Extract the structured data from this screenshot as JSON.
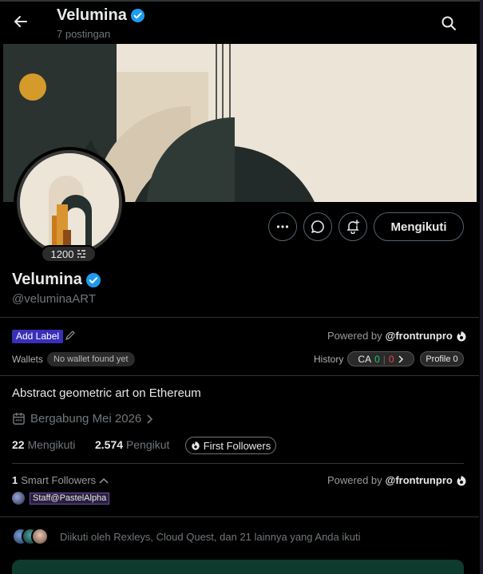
{
  "header": {
    "title": "Velumina",
    "subtitle": "7 postingan",
    "back_icon": "arrow-left-icon",
    "search_icon": "search-icon"
  },
  "profile": {
    "display_name": "Velumina",
    "handle": "@veluminaART",
    "verified_color": "#1d9bf0",
    "score": "1200",
    "bio": "Abstract geometric art on Ethereum",
    "joined": "Bergabung Mei 2026",
    "following_count": "22",
    "following_label": "Mengikuti",
    "followers_count": "2.574",
    "followers_label": "Pengikut"
  },
  "actions": {
    "more_icon": "more-icon",
    "message_icon": "message-icon",
    "notify_icon": "bell-plus-icon",
    "follow_label": "Mengikuti"
  },
  "frontrun": {
    "add_label": "Add Label",
    "powered_by": "Powered by",
    "brand": "@frontrunpro",
    "wallets_label": "Wallets",
    "no_wallet": "No wallet found yet",
    "history_label": "History",
    "ca_label": "CA",
    "ca_green": "0",
    "ca_red": "0",
    "profile_label": "Profile 0",
    "first_followers": "First Followers",
    "smart_count": "1",
    "smart_label": "Smart Followers",
    "staff_tag": "Staff@PastelAlpha"
  },
  "followed_by": "Diikuti oleh Rexleys, Cloud Quest, dan 21 lainnya yang Anda ikuti"
}
